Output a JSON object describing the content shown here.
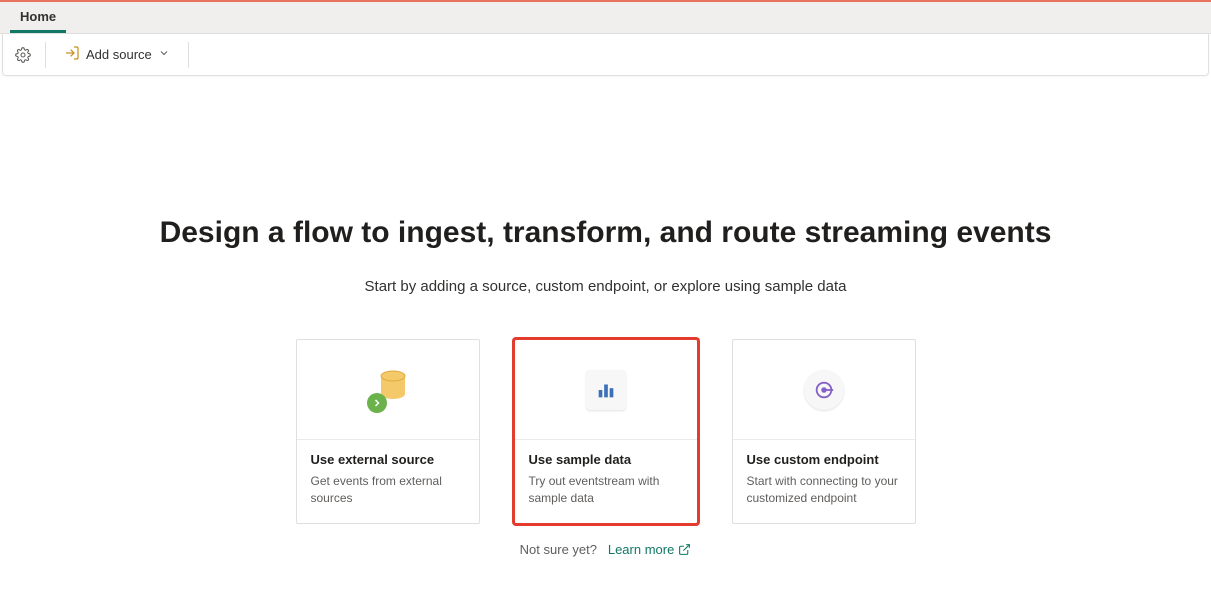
{
  "tabs": {
    "home": "Home"
  },
  "toolbar": {
    "add_source_label": "Add source"
  },
  "hero": {
    "title": "Design a flow to ingest, transform, and route streaming events",
    "subtitle": "Start by adding a source, custom endpoint, or explore using sample data"
  },
  "cards": {
    "external": {
      "title": "Use external source",
      "desc": "Get events from external sources"
    },
    "sample": {
      "title": "Use sample data",
      "desc": "Try out eventstream with sample data"
    },
    "custom": {
      "title": "Use custom endpoint",
      "desc": "Start with connecting to your customized endpoint"
    }
  },
  "footer": {
    "not_sure": "Not sure yet?",
    "learn_more": "Learn more"
  }
}
